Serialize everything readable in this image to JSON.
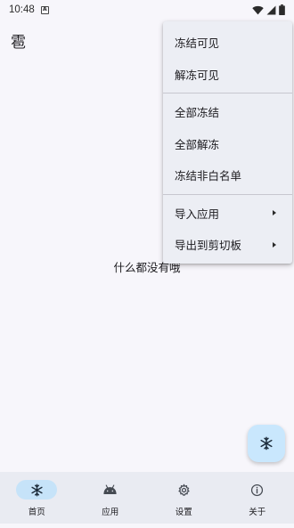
{
  "status_bar": {
    "time": "10:48",
    "notif_icon": "A"
  },
  "app": {
    "title": "雹",
    "empty_message": "什么都没有哦"
  },
  "menu": {
    "items": [
      {
        "label": "冻结可见"
      },
      {
        "label": "解冻可见"
      },
      {
        "label": "全部冻结"
      },
      {
        "label": "全部解冻"
      },
      {
        "label": "冻结非白名单"
      },
      {
        "label": "导入应用",
        "submenu": true
      },
      {
        "label": "导出到剪切板",
        "submenu": true
      }
    ]
  },
  "fab": {
    "icon": "snowflake-icon"
  },
  "bottom_nav": {
    "items": [
      {
        "label": "首页",
        "icon": "snowflake-icon",
        "active": true
      },
      {
        "label": "应用",
        "icon": "android-icon",
        "active": false
      },
      {
        "label": "设置",
        "icon": "gear-icon",
        "active": false
      },
      {
        "label": "关于",
        "icon": "info-icon",
        "active": false
      }
    ]
  },
  "colors": {
    "background": "#f7f6fb",
    "menu_background": "#eceef4",
    "fab_background": "#c9e7fd",
    "nav_background": "#e9ebf2",
    "nav_active_pill": "#c6e3f9"
  }
}
